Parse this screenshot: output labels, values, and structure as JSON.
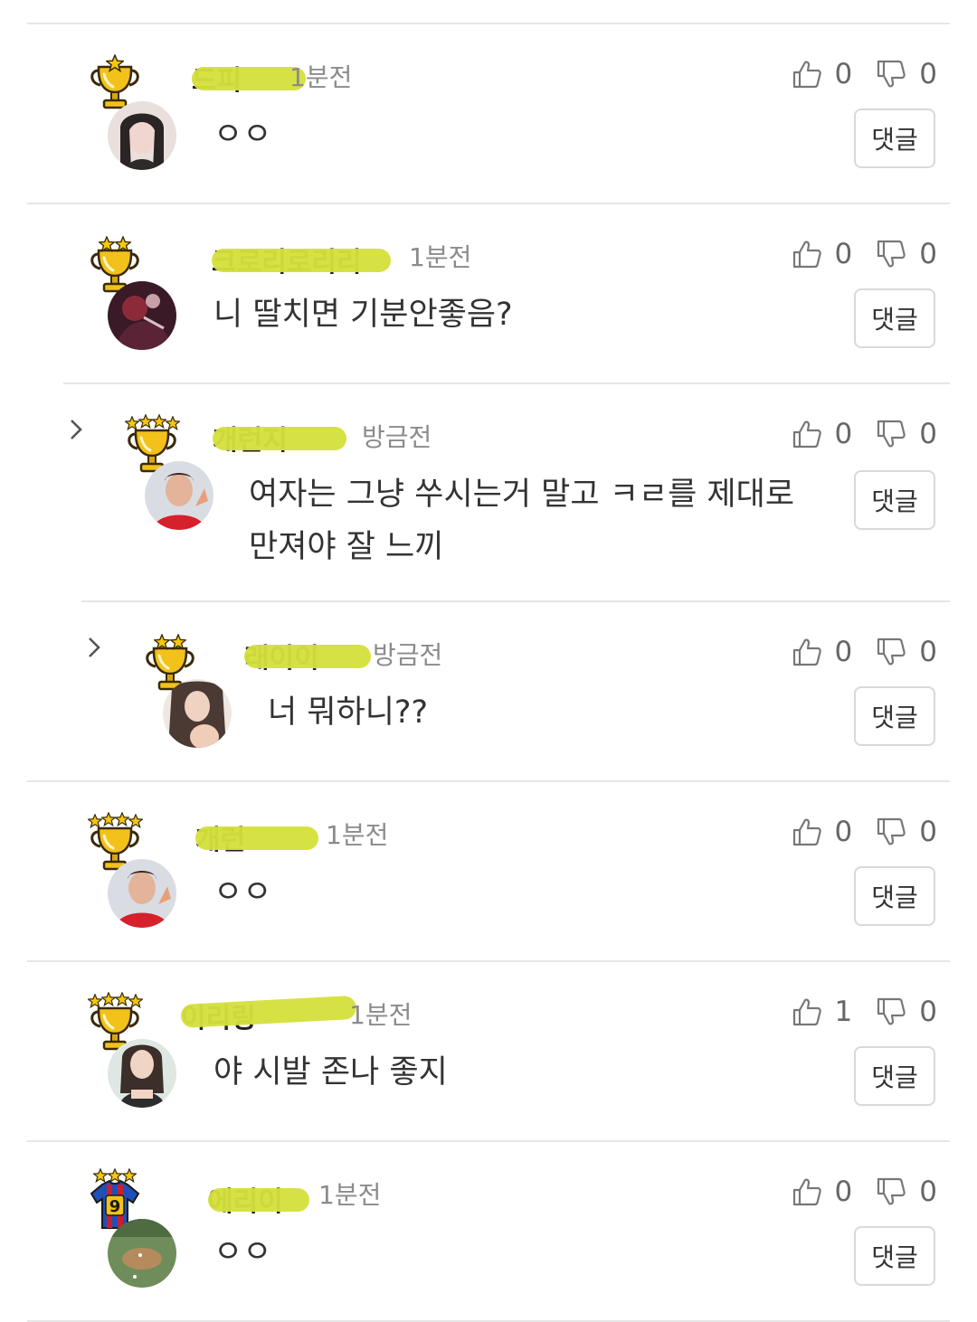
{
  "reply_label": "댓글",
  "colors": {
    "marker": "#d4e03c",
    "divider": "#e6e6e6",
    "time": "#8b8b8b"
  },
  "comments": [
    {
      "name": "드피",
      "time": "1분전",
      "text": "ㅇㅇ",
      "likes": "0",
      "dislikes": "0",
      "badge": "trophy-1-star-icon"
    },
    {
      "name": "크로리로리리",
      "time": "1분전",
      "text": "니 딸치면 기분안좋음?",
      "likes": "0",
      "dislikes": "0",
      "badge": "trophy-2-star-icon"
    },
    {
      "name": "개런지",
      "time": "방금전",
      "text": "여자는 그냥 쑤시는거 말고 ㅋㄹ를 제대로 만져야 잘 느끼",
      "likes": "0",
      "dislikes": "0",
      "badge": "trophy-4-star-icon"
    },
    {
      "name": "래이이",
      "time": "방금전",
      "text": "너 뭐하니??",
      "likes": "0",
      "dislikes": "0",
      "badge": "trophy-2-star-icon"
    },
    {
      "name": "개런",
      "time": "1분전",
      "text": "ㅇㅇ",
      "likes": "0",
      "dislikes": "0",
      "badge": "trophy-4-star-icon"
    },
    {
      "name": "이리링",
      "time": "1분전",
      "text": "야 시발 존나 좋지",
      "likes": "1",
      "dislikes": "0",
      "badge": "trophy-4-star-icon"
    },
    {
      "name": "에리이",
      "time": "1분전",
      "text": "ㅇㅇ",
      "likes": "0",
      "dislikes": "0",
      "badge": "jersey-9-3-star-icon"
    }
  ]
}
